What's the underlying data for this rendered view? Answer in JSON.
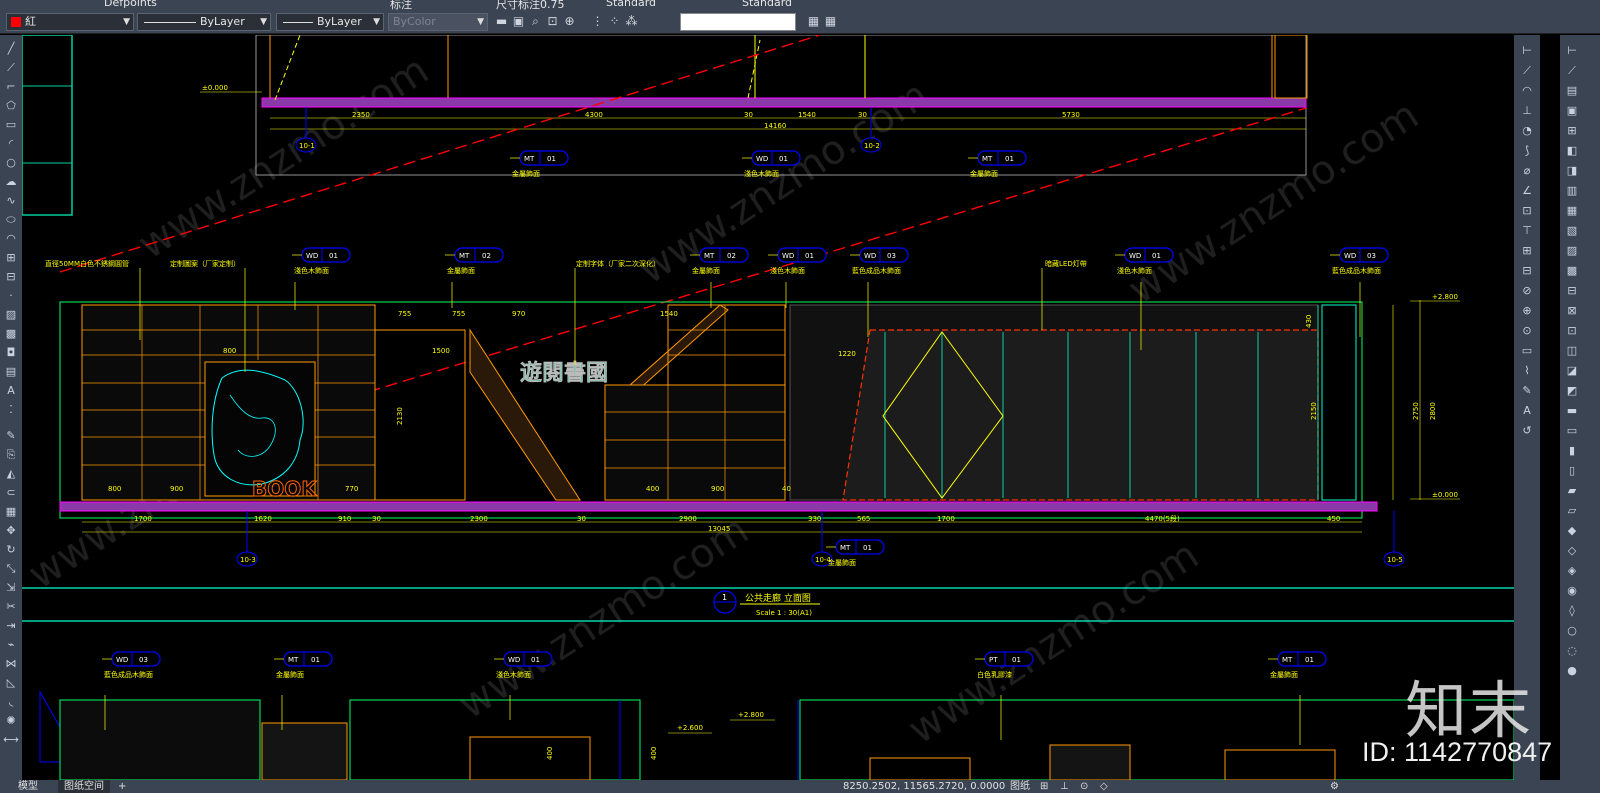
{
  "toolbar_top": {
    "layer_label": "Defpoints",
    "style_label": "标注",
    "dimstyle_label": "尺寸标注0.75",
    "textstyle_label": "Standard",
    "tablestyle_label": "Standard"
  },
  "toolbar": {
    "color": "紅",
    "color_hex": "#ff0000",
    "linetype": "ByLayer",
    "lineweight": "ByLayer",
    "plotstyle": "ByColor"
  },
  "drawing": {
    "top_section": {
      "dims": [
        "2350",
        "4300",
        "30",
        "1540",
        "30",
        "5730"
      ],
      "total_dim": "14160",
      "axes": [
        "10-1",
        "10-2"
      ],
      "level": "±0.000",
      "tags": [
        {
          "code": "MT",
          "num": "01",
          "desc": "金屬飾面"
        },
        {
          "code": "WD",
          "num": "01",
          "desc": "淺色木飾面"
        },
        {
          "code": "MT",
          "num": "01",
          "desc": "金屬飾面"
        }
      ]
    },
    "main_section": {
      "callouts": [
        "直徑50MM白色不銹鋼圓管",
        "定制圖案（厂家定制）",
        "定制字体（厂家二次深化）",
        "暗藏LED灯帶"
      ],
      "tags": [
        {
          "code": "WD",
          "num": "01",
          "desc": "淺色木飾面"
        },
        {
          "code": "MT",
          "num": "02",
          "desc": "金屬飾面"
        },
        {
          "code": "MT",
          "num": "02",
          "desc": "金屬飾面"
        },
        {
          "code": "WD",
          "num": "01",
          "desc": "淺色木飾面"
        },
        {
          "code": "WD",
          "num": "03",
          "desc": "藍色成品木飾面"
        },
        {
          "code": "WD",
          "num": "01",
          "desc": "淺色木飾面"
        },
        {
          "code": "WD",
          "num": "03",
          "desc": "藍色成品木飾面"
        }
      ],
      "bottom_tag": {
        "code": "MT",
        "num": "01",
        "desc": "金屬飾面"
      },
      "dims": [
        "1700",
        "1620",
        "910",
        "30",
        "2300",
        "30",
        "2900",
        "330",
        "565",
        "1700",
        "4470(5段)",
        "450"
      ],
      "total_dim": "13045",
      "axes": [
        "10-3",
        "10-4",
        "10-5"
      ],
      "inner_dims": [
        "755",
        "755",
        "970",
        "1540",
        "1500",
        "1220",
        "2130",
        "2150",
        "2750",
        "2800",
        "430",
        "800",
        "900",
        "770",
        "800",
        "900",
        "400",
        "40"
      ],
      "levels": [
        "+2.800",
        "±0.000"
      ],
      "book_text": "BOOK",
      "sign_text": "遊閱書國"
    },
    "title_block": {
      "num": "1",
      "title": "公共走廊  立面图",
      "scale": "Scale 1 : 30(A1)"
    },
    "lower_section": {
      "tags": [
        {
          "code": "WD",
          "num": "03",
          "desc": "藍色成品木飾面"
        },
        {
          "code": "MT",
          "num": "01",
          "desc": "金屬飾面"
        },
        {
          "code": "WD",
          "num": "01",
          "desc": "淺色木飾面"
        },
        {
          "code": "PT",
          "num": "01",
          "desc": "白色乳膠漆"
        },
        {
          "code": "MT",
          "num": "01",
          "desc": "金屬飾面"
        }
      ],
      "levels": [
        "+2.600",
        "+2.800"
      ],
      "dims": [
        "400",
        "400"
      ]
    },
    "watermark": "www.znzmo.com"
  },
  "watermark_logo": "知末",
  "watermark_id": "ID: 1142770847",
  "status": {
    "tab_model": "模型",
    "tab_layout": "图纸空间",
    "coords": "8250.2502, 11565.2720, 0.0000",
    "mode": "图纸"
  },
  "colors": {
    "yellow": "#ffff00",
    "magenta": "#ff00ff",
    "cyan": "#00ffff",
    "red": "#ff0000",
    "blue": "#0000ff",
    "green": "#00ff66",
    "orange": "#ff9900",
    "ui_bg": "#3b4453"
  }
}
